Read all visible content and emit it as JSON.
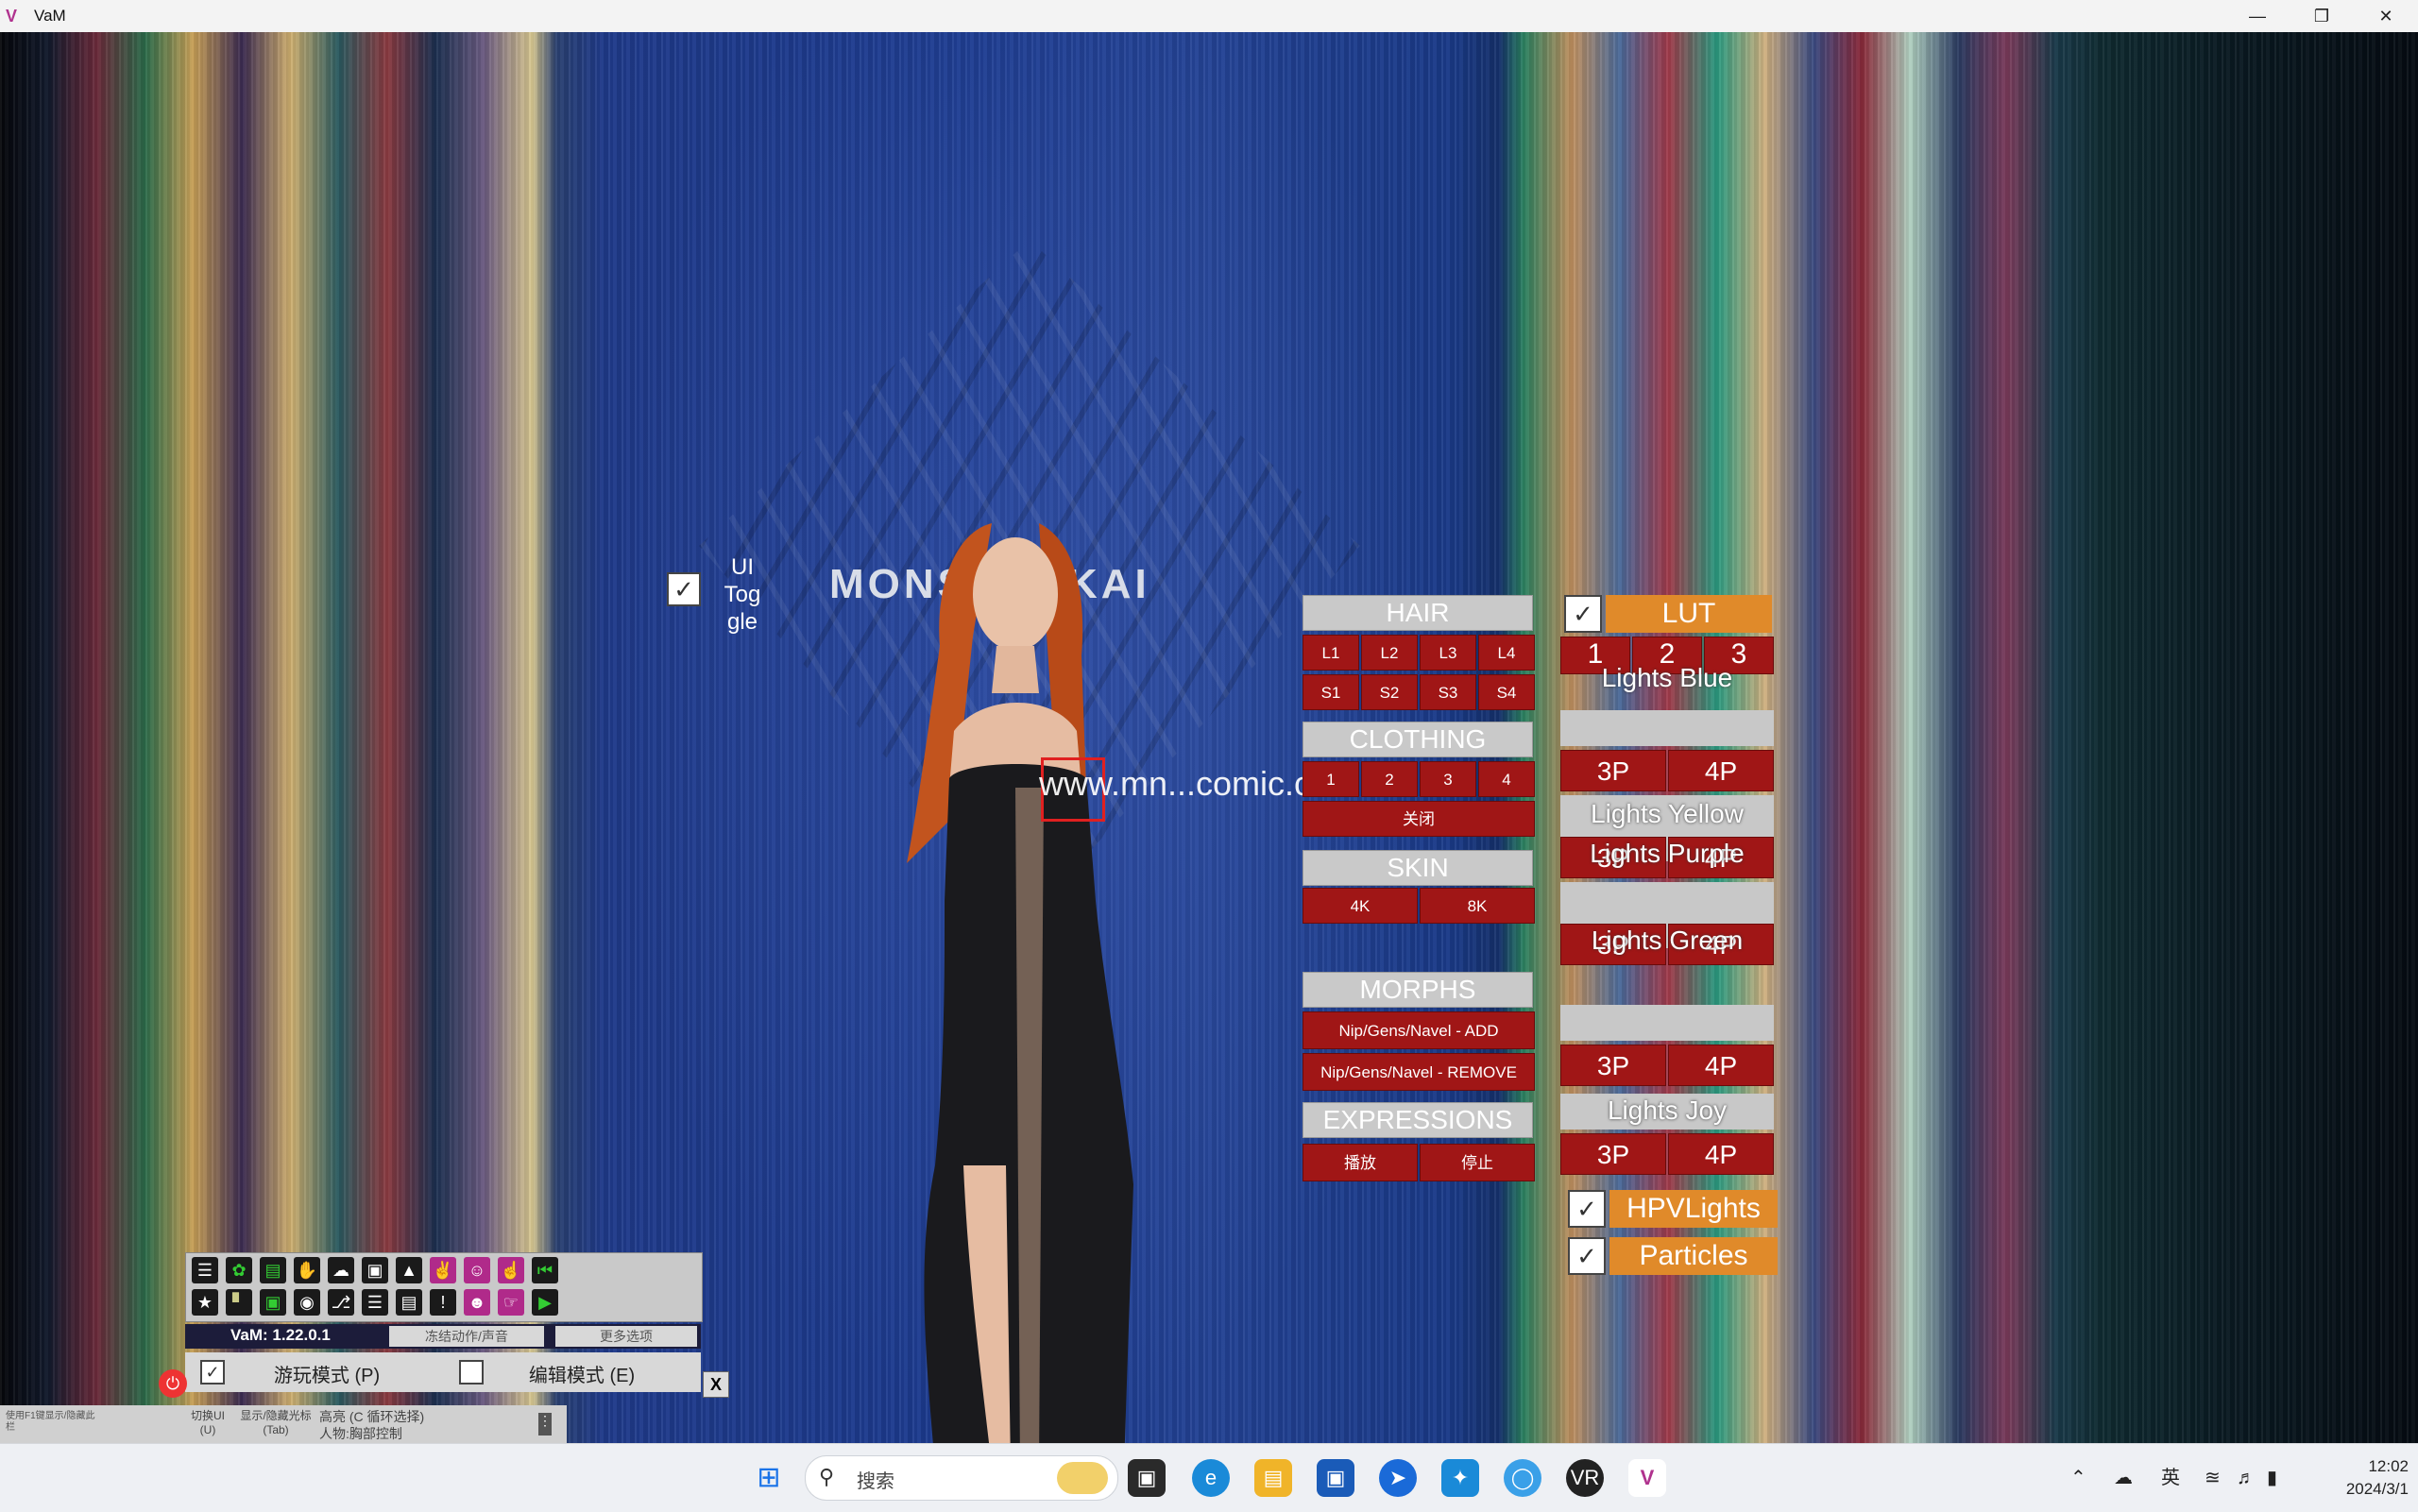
{
  "window": {
    "title": "VaM",
    "controls": [
      "minimize",
      "restore",
      "close"
    ]
  },
  "scene": {
    "brand_text": "MONS        HINKAI",
    "watermark": "www.mn...comic.cc"
  },
  "ui_toggle": {
    "label_line1": "UI",
    "label_line2": "Tog",
    "label_line3": "gle",
    "checked": true
  },
  "left_panel": {
    "hair": {
      "title": "HAIR",
      "row1": [
        "L1",
        "L2",
        "L3",
        "L4"
      ],
      "row2": [
        "S1",
        "S2",
        "S3",
        "S4"
      ]
    },
    "clothing": {
      "title": "CLOTHING",
      "row1": [
        "1",
        "2",
        "3",
        "4"
      ],
      "close": "关闭"
    },
    "skin": {
      "title": "SKIN",
      "buttons": [
        "4K",
        "8K"
      ]
    },
    "morphs": {
      "title": "MORPHS",
      "add": "Nip/Gens/Navel - ADD",
      "remove": "Nip/Gens/Navel - REMOVE"
    },
    "expressions": {
      "title": "EXPRESSIONS",
      "play": "播放",
      "stop": "停止"
    }
  },
  "right_panel": {
    "lut": {
      "label": "LUT",
      "checked": true,
      "numbers": [
        "1",
        "2",
        "3"
      ]
    },
    "lights_blue": "Lights Blue",
    "lights_yellow": "Lights Yellow",
    "lights_purple": "Lights Purple",
    "lights_green": "Lights Green",
    "lights_joy": "Lights Joy",
    "p3": "3P",
    "p4": "4P",
    "hpvlights": {
      "label": "HPVLights",
      "checked": true
    },
    "particles": {
      "label": "Particles",
      "checked": true
    }
  },
  "toolbar": {
    "version": "VaM: 1.22.0.1",
    "freeze_label": "冻结动作/声音",
    "more_options": "更多选项",
    "play_mode": "游玩模式 (P)",
    "edit_mode": "编辑模式 (E)",
    "close_x": "X",
    "hint_left": "使用F1键显示/隐藏此栏",
    "toggle_ui": "切换UI (U)",
    "show_cursor": "显示/隐藏光标 (Tab)",
    "highlight": "高亮 (C 循环选择)",
    "person_control": "人物:胸部控制",
    "icons": [
      "menu-icon",
      "leaf-icon",
      "folder-icon",
      "hand-icon",
      "cloud-icon",
      "cube-icon",
      "package-icon",
      "glove-icon",
      "person-icon",
      "touch-icon",
      "skip-back-icon",
      "star-icon",
      "shoe-icon",
      "screenshot-icon",
      "camera-icon",
      "tree-icon",
      "layers-icon",
      "document-icon",
      "alert-icon",
      "user-icon",
      "pointer-icon",
      "play-icon"
    ]
  },
  "taskbar": {
    "search_placeholder": "搜索",
    "ime": "英",
    "time": "12:02",
    "date": "2024/3/1"
  }
}
